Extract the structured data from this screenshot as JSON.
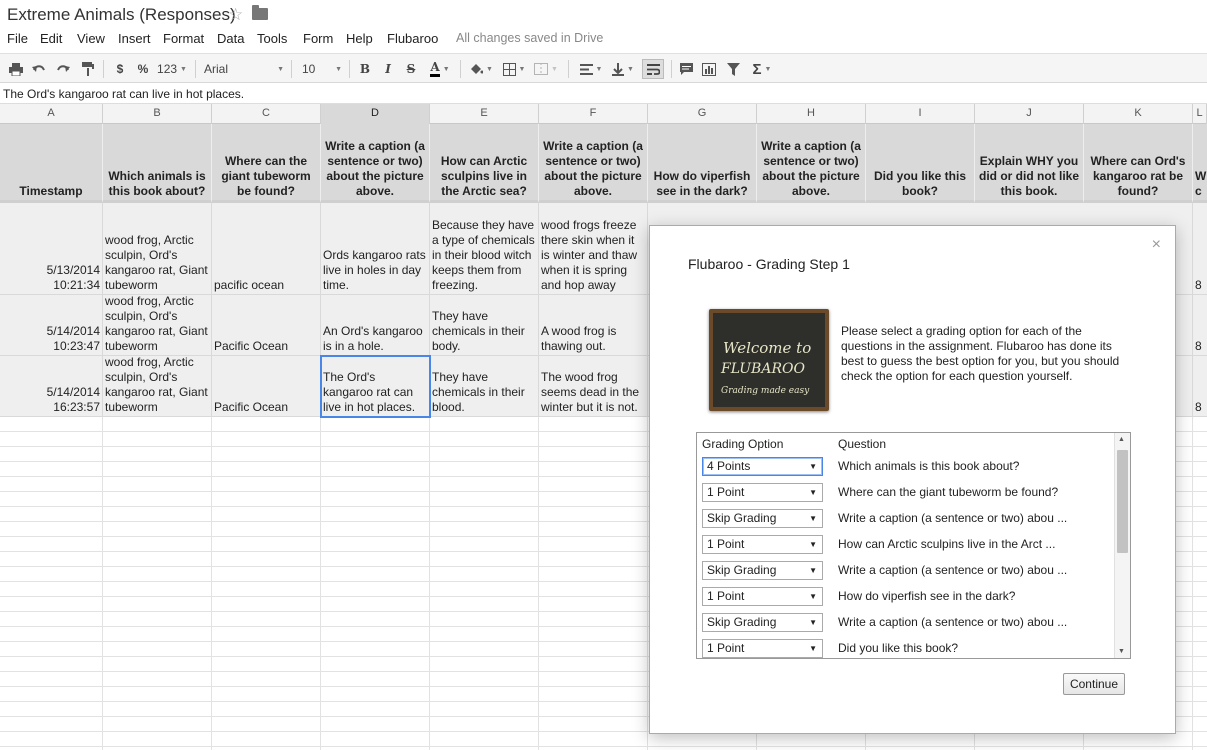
{
  "app": {
    "doc_title": "Extreme Animals (Responses)",
    "star_icon": "☆",
    "folder_icon": "folder-icon"
  },
  "menu": {
    "items": [
      "File",
      "Edit",
      "View",
      "Insert",
      "Format",
      "Data",
      "Tools",
      "Form",
      "Help",
      "Flubaroo"
    ],
    "saved_status": "All changes saved in Drive"
  },
  "toolbar": {
    "currency": "$",
    "percent": "%",
    "number_format": "123",
    "font": "Arial",
    "font_size": "10",
    "bold": "B",
    "italic": "I",
    "strike": "S",
    "text_color": "A"
  },
  "formula_bar": {
    "value": "The Ord's kangaroo rat can live in hot places."
  },
  "sheet": {
    "column_letters": [
      "A",
      "B",
      "C",
      "D",
      "E",
      "F",
      "G",
      "H",
      "I",
      "J",
      "K",
      "L"
    ],
    "selected_column": "D",
    "headers": [
      "Timestamp",
      "Which animals is this book about?",
      "Where can the giant tubeworm be found?",
      "Write a caption (a sentence or two) about the picture above.",
      "How can Arctic sculpins live in the Arctic sea?",
      "Write a caption (a sentence or two) about the picture above.",
      "How do viperfish see in the dark?",
      "Write a caption (a sentence or two) about the picture above.",
      "Did you like this book?",
      "Explain WHY you did or did not like this book.",
      "Where can Ord's kangaroo rat be found?",
      "W c"
    ],
    "rows": [
      {
        "timestamp": "5/13/2014 10:21:34",
        "animals": "wood frog, Arctic sculpin, Ord's kangaroo rat, Giant tubeworm",
        "tubeworm": "pacific ocean",
        "caption1": "Ords kangaroo rats live in holes in day time.",
        "sculpins": "Because they have a type of chemicals in their blood witch keeps them from freezing.",
        "caption2": "wood frogs freeze there skin when it is winter and thaw when it is spring and hop away",
        "extra": "8"
      },
      {
        "timestamp": "5/14/2014 10:23:47",
        "animals": "wood frog, Arctic sculpin, Ord's kangaroo rat, Giant tubeworm",
        "tubeworm": "Pacific Ocean",
        "caption1": "An Ord's kangaroo is in a hole.",
        "sculpins": "They have chemicals in their body.",
        "caption2": "A wood frog is thawing out.",
        "extra": "8"
      },
      {
        "timestamp": "5/14/2014 16:23:57",
        "animals": "wood frog, Arctic sculpin, Ord's kangaroo rat, Giant tubeworm",
        "tubeworm": "Pacific Ocean",
        "caption1": "The Ord's kangaroo rat can live in hot places.",
        "sculpins": "They have chemicals in their blood.",
        "caption2": "The wood frog seems dead in the winter but it is not.",
        "extra": "8"
      }
    ]
  },
  "dialog": {
    "title": "Flubaroo - Grading Step 1",
    "close_icon": "×",
    "image_caption_line1": "Welcome to",
    "image_caption_line2": "FLUBAROO",
    "image_caption_line3": "Grading made easy",
    "description": "Please select a grading option for each of the questions in the assignment. Flubaroo has done its best to guess the best option for you, but you should check the option for each question yourself.",
    "col_option": "Grading Option",
    "col_question": "Question",
    "options": [
      {
        "value": "4 Points",
        "question": "Which animals is this book about?"
      },
      {
        "value": "1 Point",
        "question": "Where can the giant tubeworm be found?"
      },
      {
        "value": "Skip Grading",
        "question": "Write a caption (a sentence or two) abou ..."
      },
      {
        "value": "1 Point",
        "question": "How can Arctic sculpins live in the Arct ..."
      },
      {
        "value": "Skip Grading",
        "question": "Write a caption (a sentence or two) abou ..."
      },
      {
        "value": "1 Point",
        "question": "How do viperfish see in the dark?"
      },
      {
        "value": "Skip Grading",
        "question": "Write a caption (a sentence or two) abou ..."
      },
      {
        "value": "1 Point",
        "question": "Did you like this book?"
      }
    ],
    "continue_label": "Continue"
  }
}
